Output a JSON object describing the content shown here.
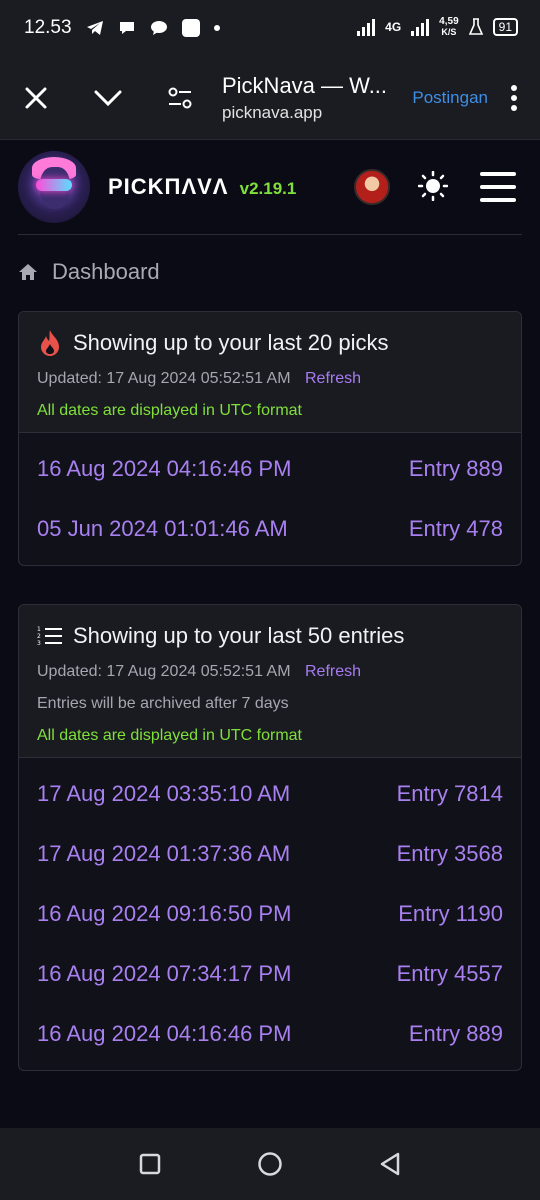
{
  "status": {
    "time": "12.53",
    "network": "4G",
    "speed": "4,59",
    "speed_unit": "K/S",
    "battery": "91"
  },
  "browser": {
    "title": "PickNava — W...",
    "url": "picknava.app",
    "post_label": "Postingan"
  },
  "app": {
    "brand": "PICKΠΛVΛ",
    "version": "v2.19.1",
    "accent": "#7fe03a"
  },
  "breadcrumb": {
    "label": "Dashboard"
  },
  "picks_card": {
    "title": "Showing up to your last 20 picks",
    "updated": "Updated: 17 Aug 2024 05:52:51 AM",
    "refresh": "Refresh",
    "utc_note": "All dates are displayed in UTC format",
    "rows": [
      {
        "date": "16 Aug 2024 04:16:46 PM",
        "entry": "Entry 889"
      },
      {
        "date": "05 Jun 2024 01:01:46 AM",
        "entry": "Entry 478"
      }
    ]
  },
  "entries_card": {
    "title": "Showing up to your last 50 entries",
    "updated": "Updated: 17 Aug 2024 05:52:51 AM",
    "refresh": "Refresh",
    "archive_note": "Entries will be archived after 7 days",
    "utc_note": "All dates are displayed in UTC format",
    "rows": [
      {
        "date": "17 Aug 2024 03:35:10 AM",
        "entry": "Entry 7814"
      },
      {
        "date": "17 Aug 2024 01:37:36 AM",
        "entry": "Entry 3568"
      },
      {
        "date": "16 Aug 2024 09:16:50 PM",
        "entry": "Entry 1190"
      },
      {
        "date": "16 Aug 2024 07:34:17 PM",
        "entry": "Entry 4557"
      },
      {
        "date": "16 Aug 2024 04:16:46 PM",
        "entry": "Entry 889"
      }
    ]
  },
  "colors": {
    "background": "#0b0b16",
    "link": "#a77cf2",
    "utc": "#7fe03a"
  }
}
